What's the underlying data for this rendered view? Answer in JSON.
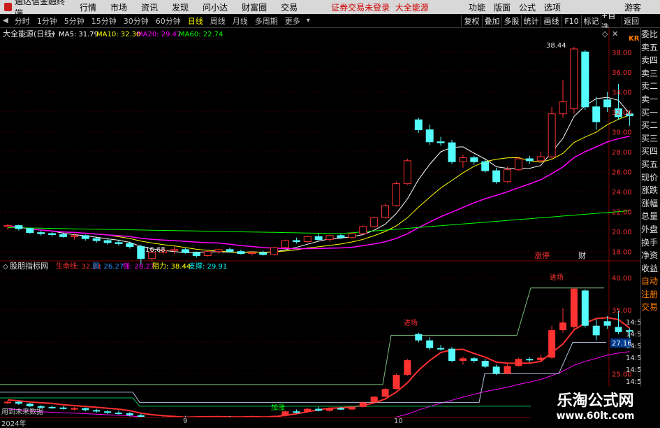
{
  "app": {
    "title": "通达信金融终端"
  },
  "menu": [
    "行情",
    "市场",
    "资讯",
    "发现",
    "问小达",
    "财富圈",
    "交易"
  ],
  "notice": {
    "login": "证券交易未登录",
    "stock": "大全能源"
  },
  "menu_right": [
    "功能",
    "版面",
    "公式",
    "选项"
  ],
  "guest": "游客",
  "periods": [
    "分时",
    "1分钟",
    "5分钟",
    "15分钟",
    "30分钟",
    "60分钟",
    "日线",
    "周线",
    "月线",
    "多周期",
    "更多"
  ],
  "active_period": "日线",
  "toolbar": [
    "复权",
    "叠加",
    "多股",
    "统计",
    "画线",
    "F10",
    "标记",
    "+自选",
    "返回"
  ],
  "main_title": "大全能源(日线)",
  "ma": [
    {
      "label": "MA5: 31.79",
      "color": "#ffffff"
    },
    {
      "label": "MA10: 32.30",
      "color": "#ffff00"
    },
    {
      "label": "MA20: 29.47",
      "color": "#ff00ff"
    },
    {
      "label": "MA60: 22.74",
      "color": "#00ff00"
    }
  ],
  "sub_title": "股朋指标网",
  "sub_values": [
    {
      "label": "生命线: 32.21",
      "color": "#ff3030"
    },
    {
      "label": "弱: 26.27",
      "color": "#1e90ff"
    },
    {
      "label": "强: 28.27",
      "color": "#ff00ff"
    },
    {
      "label": "阻力: 38.44",
      "color": "#ffff00"
    },
    {
      "label": "支撑: 29.91",
      "color": "#00ffff"
    }
  ],
  "price_ticks": [
    "38.00",
    "36.00",
    "34.00",
    "32.00",
    "30.00",
    "28.00",
    "26.00",
    "24.00",
    "22.00",
    "20.00",
    "18.00"
  ],
  "sub_ticks": [
    "40.00",
    "35.00",
    "30.00",
    "25.00"
  ],
  "sub_ticks_extra": [
    "14:56",
    "14:56",
    "14:56",
    "14:56",
    "14:56",
    "14:56"
  ],
  "current_sub_value": "27.16",
  "annotations": {
    "high": "38.44",
    "low": "16.68",
    "zhangting": "涨停",
    "cai": "财",
    "jinjian": "进场",
    "jiazhang": "加涨",
    "future": "用到未来数据"
  },
  "dates": [
    "2024年",
    "9",
    "10"
  ],
  "corner_tag": "KR",
  "right_panel": [
    "委比",
    "卖五",
    "卖四",
    "卖三",
    "卖二",
    "卖一",
    "买一",
    "买二",
    "买三",
    "买四",
    "买五",
    "现价",
    "涨跌",
    "涨幅",
    "总量",
    "外盘",
    "换手",
    "净资",
    "收益",
    "自动",
    "注册",
    "交易"
  ],
  "watermark": {
    "title": "乐淘公式网",
    "url": "www.60lt.com"
  },
  "colors": {
    "up": "#ff3232",
    "down": "#54fcfc",
    "grid": "#800000",
    "lifeline": "#ff3030"
  },
  "chart_data": {
    "type": "candlestick",
    "title": "大全能源(日线)",
    "candles": [
      [
        20.5,
        20.8,
        20.2,
        20.6
      ],
      [
        20.6,
        20.7,
        20.1,
        20.3
      ],
      [
        20.3,
        20.4,
        19.8,
        19.9
      ],
      [
        19.9,
        20.1,
        19.6,
        19.8
      ],
      [
        19.8,
        20.0,
        19.5,
        19.7
      ],
      [
        19.7,
        19.9,
        19.4,
        19.5
      ],
      [
        19.5,
        19.8,
        19.2,
        19.6
      ],
      [
        19.6,
        19.7,
        19.1,
        19.3
      ],
      [
        19.3,
        19.5,
        18.9,
        19.1
      ],
      [
        19.1,
        19.3,
        18.7,
        18.9
      ],
      [
        18.9,
        19.2,
        18.6,
        18.8
      ],
      [
        18.8,
        19.0,
        18.3,
        18.5
      ],
      [
        18.5,
        18.7,
        16.7,
        17.3
      ],
      [
        17.3,
        18.2,
        17.1,
        17.9
      ],
      [
        17.9,
        18.4,
        17.7,
        18.1
      ],
      [
        18.1,
        18.5,
        17.8,
        18.2
      ],
      [
        18.2,
        18.4,
        17.8,
        17.9
      ],
      [
        17.9,
        18.0,
        17.4,
        17.6
      ],
      [
        17.6,
        18.1,
        17.5,
        18.0
      ],
      [
        18.0,
        18.3,
        17.8,
        18.2
      ],
      [
        18.2,
        18.4,
        17.9,
        18.0
      ],
      [
        18.0,
        18.2,
        17.7,
        17.8
      ],
      [
        17.8,
        18.0,
        17.6,
        17.9
      ],
      [
        17.9,
        18.1,
        17.6,
        17.7
      ],
      [
        17.7,
        18.5,
        17.6,
        18.4
      ],
      [
        18.4,
        19.2,
        18.3,
        19.1
      ],
      [
        19.1,
        19.4,
        18.8,
        19.0
      ],
      [
        19.0,
        19.6,
        18.9,
        19.5
      ],
      [
        19.5,
        19.8,
        19.1,
        19.2
      ],
      [
        19.2,
        19.7,
        19.0,
        19.6
      ],
      [
        19.6,
        19.8,
        19.3,
        19.4
      ],
      [
        19.4,
        19.9,
        19.3,
        19.8
      ],
      [
        19.8,
        20.6,
        19.7,
        20.5
      ],
      [
        20.5,
        21.5,
        20.4,
        21.4
      ],
      [
        21.4,
        22.8,
        21.3,
        22.6
      ],
      [
        22.6,
        25.0,
        22.5,
        24.8
      ],
      [
        24.8,
        27.3,
        24.7,
        27.1
      ],
      [
        31.2,
        31.4,
        29.9,
        30.2
      ],
      [
        30.2,
        30.7,
        28.7,
        29.0
      ],
      [
        29.0,
        29.5,
        28.6,
        28.9
      ],
      [
        28.9,
        29.2,
        26.8,
        27.0
      ],
      [
        27.0,
        27.7,
        26.4,
        27.4
      ],
      [
        27.4,
        27.6,
        26.7,
        27.0
      ],
      [
        27.0,
        27.3,
        25.9,
        26.1
      ],
      [
        26.1,
        26.4,
        24.8,
        25.0
      ],
      [
        25.0,
        26.5,
        24.9,
        26.2
      ],
      [
        26.2,
        27.5,
        26.1,
        27.3
      ],
      [
        27.3,
        27.6,
        26.8,
        27.1
      ],
      [
        27.1,
        28.0,
        26.9,
        27.5
      ],
      [
        27.5,
        32.5,
        27.3,
        31.8
      ],
      [
        31.8,
        35.2,
        31.4,
        33.0
      ],
      [
        32.3,
        38.5,
        31.8,
        38.3
      ],
      [
        38.0,
        38.2,
        32.2,
        32.5
      ],
      [
        32.5,
        33.5,
        30.2,
        31.0
      ],
      [
        33.2,
        34.0,
        32.0,
        32.5
      ],
      [
        32.3,
        34.8,
        31.2,
        31.5
      ],
      [
        31.8,
        32.1,
        30.6,
        31.6
      ]
    ],
    "ma5_last": 31.79,
    "ma10_last": 32.3,
    "ma20_last": 29.47,
    "ma60_last": 22.74,
    "ylim": [
      17,
      39
    ]
  }
}
